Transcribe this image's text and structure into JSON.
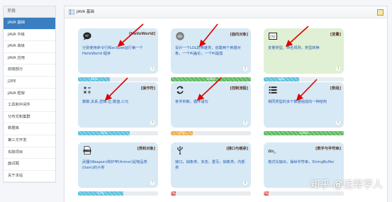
{
  "sidebar": {
    "header": "阶段",
    "items": [
      {
        "label": "JAVA 基础",
        "active": true
      },
      {
        "label": "JAVA 中级",
        "active": false
      },
      {
        "label": "JAVA 高级",
        "active": false
      },
      {
        "label": "JAVA 应用",
        "active": false
      },
      {
        "label": "前端部分",
        "active": false
      },
      {
        "label": "J2EE",
        "active": false
      },
      {
        "label": "JAVA 框架",
        "active": false
      },
      {
        "label": "工具和中间件",
        "active": false
      },
      {
        "label": "分布式和集群",
        "active": false
      },
      {
        "label": "数据库",
        "active": false
      },
      {
        "label": "第三方开发",
        "active": false
      },
      {
        "label": "实践项目",
        "active": false
      },
      {
        "label": "面试题",
        "active": false
      },
      {
        "label": "关于本站",
        "active": false
      }
    ]
  },
  "panel": {
    "title": "JAVA 基础"
  },
  "cards": [
    {
      "tag": "[HelloWorld]",
      "desc": "分别使用命令行和eclipse运行第一个 HelloWorld 程序",
      "num": "1",
      "icon": "chat-bubble-icon",
      "color": "blue",
      "progress": {
        "value": 0.4,
        "label": "40%",
        "color": "#5bc0de"
      }
    },
    {
      "tag": "[面向对象]",
      "desc": "设计一个LOL的英雄类，创建两个英雄对象，一个叫盖伦，一个叫提莫",
      "num": "2",
      "icon": "hero-avatar-icon",
      "color": "blue",
      "progress": {
        "value": 1.0,
        "label": "100%",
        "color": "#5cb85c"
      }
    },
    {
      "tag": "[变量]",
      "desc": "变量类型，命名规则，类型转换",
      "num": "3",
      "icon": "variable-icon",
      "color": "green",
      "progress": {
        "value": 0.44,
        "label": "44%",
        "color": "#5bc0de"
      }
    },
    {
      "tag": "[操作符]",
      "desc": "算数,关系,逻辑,位,赋值,三元",
      "num": "4",
      "icon": "operator-icon",
      "color": "blue",
      "progress": {
        "value": 0.65,
        "label": "65%",
        "color": "#5bc0de"
      }
    },
    {
      "tag": "[控制流程]",
      "desc": "条件判断，循环语句",
      "num": "5",
      "icon": "loop-icon",
      "color": "blue",
      "progress": {
        "value": 0.27,
        "label": "27%",
        "color": "#f0ad4e"
      }
    },
    {
      "tag": "[数组]",
      "desc": "相同类型的多个数据组成的一种结构",
      "num": "6",
      "icon": "list-icon",
      "color": "blue",
      "progress": {
        "value": 1.0,
        "label": "100%",
        "color": "#5cb85c"
      }
    },
    {
      "tag": "[类和对象]",
      "desc": "武器(Weapon)和护甲(Armor)是物品类(Item)的子类",
      "num": "7",
      "icon": "class-file-icon",
      "color": "blue",
      "progress": {
        "value": 0.57,
        "label": "57%",
        "color": "#5bc0de"
      }
    },
    {
      "tag": "[接口与继承]",
      "desc": "接口，抽象类，多态，重写，抽象类，内部类",
      "num": "8",
      "icon": "usb-icon",
      "color": "blue",
      "progress": {
        "value": 0.06,
        "label": "6%",
        "color": "#d9534f"
      }
    },
    {
      "tag": "[数字与字符串]",
      "desc": "格式化输出，操纵字符串，StringBuffer",
      "num": "9",
      "icon": "abc-icon",
      "color": "blue",
      "progress": {
        "value": 0.06,
        "label": "6%",
        "color": "#d9534f"
      }
    }
  ],
  "watermark": "知乎 @运筹学人"
}
